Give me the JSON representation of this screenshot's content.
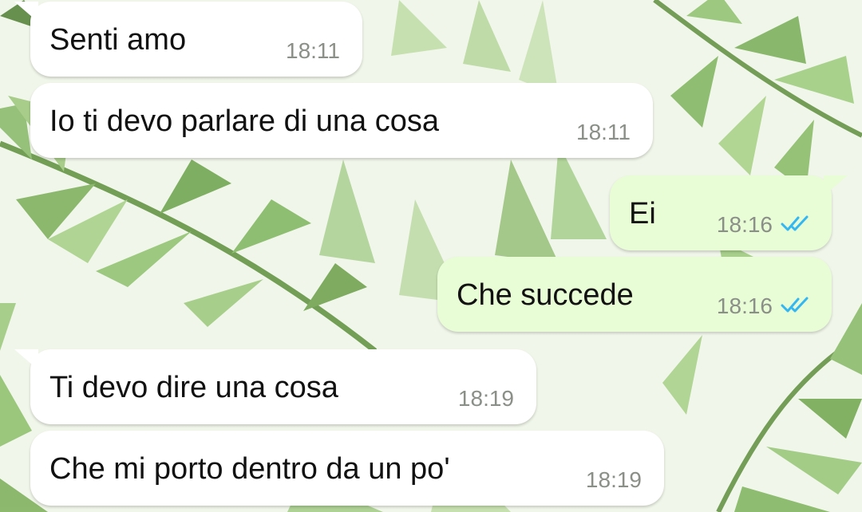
{
  "chat": {
    "messages": [
      {
        "direction": "incoming",
        "text": "Senti amo",
        "time": "18:11"
      },
      {
        "direction": "incoming",
        "text": "Io ti devo parlare di una cosa",
        "time": "18:11"
      },
      {
        "direction": "outgoing",
        "text": "Ei",
        "time": "18:16",
        "status": "read"
      },
      {
        "direction": "outgoing",
        "text": "Che succede",
        "time": "18:16",
        "status": "read"
      },
      {
        "direction": "incoming",
        "text": "Ti devo dire una cosa",
        "time": "18:19"
      },
      {
        "direction": "incoming",
        "text": "Che mi porto dentro da un po'",
        "time": "18:19"
      }
    ]
  },
  "colors": {
    "incoming_bubble": "#ffffff",
    "outgoing_bubble": "#e8fcd6",
    "read_ticks": "#34b7f1",
    "time_text": "#8a8f87",
    "wallpaper_leaf": "#7fb35a"
  },
  "icons": {
    "read_receipt": "double-check-icon"
  }
}
